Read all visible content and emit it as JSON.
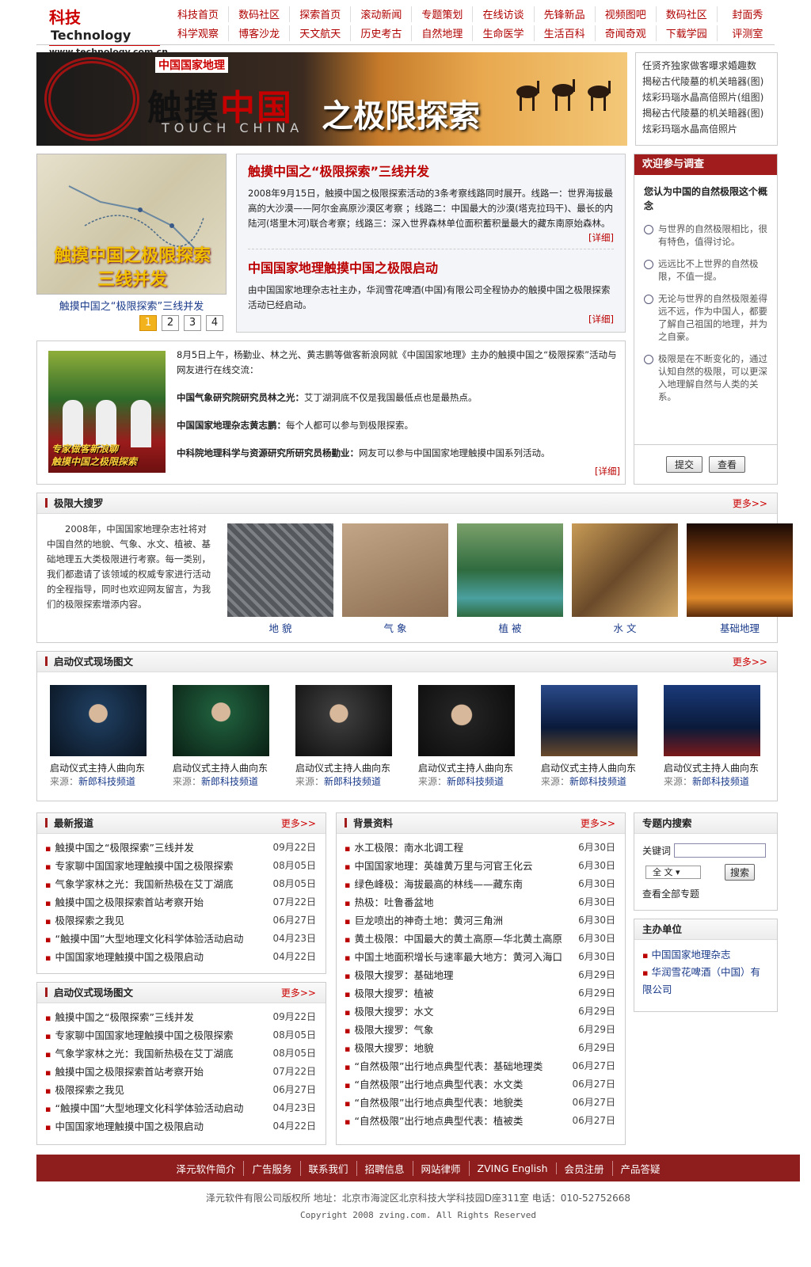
{
  "logo": {
    "cn": "科技",
    "en": "Technology",
    "url": "www.technology.com.cn"
  },
  "nav_row1": [
    "科技首页",
    "数码社区",
    "探索首页",
    "滚动新闻",
    "专题策划",
    "在线访谈",
    "先锋新品",
    "视频图吧",
    "数码社区",
    "封面秀"
  ],
  "nav_row2": [
    "科学观察",
    "博客沙龙",
    "天文航天",
    "历史考古",
    "自然地理",
    "生命医学",
    "生活百科",
    "奇闻奇观",
    "下载学园",
    "评测室"
  ],
  "banner": {
    "brand": "中国国家地理",
    "title_a": "触摸",
    "title_b": "中国",
    "english": "TOUCH CHINA",
    "title2": "之极限探索"
  },
  "banner_links": [
    "任贤齐独家做客曝求婚趣数",
    "揭秘古代陵墓的机关暗器(图)",
    "炫彩玛瑙水晶高倍照片(组图)",
    "揭秘古代陵墓的机关暗器(图)",
    "炫彩玛瑙水晶高倍照片"
  ],
  "map": {
    "overlay": "触摸中国之极限探索\n三线并发",
    "caption": "触摸中国之“极限探索”三线并发",
    "pages": [
      "1",
      "2",
      "3",
      "4"
    ]
  },
  "news": [
    {
      "title": "触摸中国之“极限探索”三线并发",
      "body": "2008年9月15日，触摸中国之极限探索活动的3条考察线路同时展开。线路一：世界海拔最高的大沙漠——阿尔金高原沙漠区考察 ；线路二：中国最大的沙漠(塔克拉玛干)、最长的内陆河(塔里木河)联合考察；线路三：深入世界森林单位面积蓄积量最大的藏东南原始森林。",
      "more": "[详细]"
    },
    {
      "title": "中国国家地理触摸中国之极限启动",
      "body": "由中国国家地理杂志社主办，华润雪花啤酒(中国)有限公司全程协办的触摸中国之极限探索活动已经启动。",
      "more": "[详细]"
    }
  ],
  "survey": {
    "header": "欢迎参与调查",
    "question": "您认为中国的自然极限这个概念",
    "options": [
      "与世界的自然极限相比，很有特色，值得讨论。",
      "远远比不上世界的自然极限，不值一提。",
      "无论与世界的自然极限差得远不远，作为中国人，都要了解自己祖国的地理，并为之自豪。",
      "极限是在不断变化的，通过认知自然的极限，可以更深入地理解自然与人类的关系。"
    ],
    "submit": "提交",
    "view": "查看"
  },
  "chat": {
    "img_text": "专家做客新浪聊\n触摸中国之极限探索",
    "intro": "8月5日上午，杨勤业、林之光、黄志鹏等做客新浪网就《中国国家地理》主办的触摸中国之“极限探索”活动与网友进行在线交流：",
    "q1_name": "中国气象研究院研究员林之光：",
    "q1_text": "艾丁湖洞底不仅是我国最低点也是最热点。",
    "q2_name": "中国国家地理杂志黄志鹏：",
    "q2_text": "每个人都可以参与到极限探索。",
    "q3_name": "中科院地理科学与资源研究所研究员杨勤业：",
    "q3_text": "网友可以参与中国国家地理触摸中国系列活动。",
    "more": "[详细]"
  },
  "sec1": {
    "title": "极限大搜罗",
    "more": "更多>>",
    "text": "2008年，中国国家地理杂志社将对中国自然的地貌、气象、水文、植被、基础地理五大类极限进行考察。每一类别，我们都邀请了该领域的权威专家进行活动的全程指导，同时也欢迎网友留言，为我们的极限探索增添内容。",
    "pics": [
      {
        "cap": "地 貌",
        "color": "#6b6e72"
      },
      {
        "cap": "气 象",
        "color": "#a9886a"
      },
      {
        "cap": "植 被",
        "color": "#2f6b3f"
      },
      {
        "cap": "水 文",
        "color": "#8a6a3a"
      },
      {
        "cap": "基础地理",
        "color": "#9a4a10"
      }
    ]
  },
  "sec2": {
    "title": "启动仪式现场图文",
    "more": "更多>>",
    "items": [
      {
        "cap": "启动仪式主持人曲向东",
        "src_label": "来源：",
        "src": "新郎科技频道"
      },
      {
        "cap": "启动仪式主持人曲向东",
        "src_label": "来源：",
        "src": "新郎科技频道"
      },
      {
        "cap": "启动仪式主持人曲向东",
        "src_label": "来源：",
        "src": "新郎科技频道"
      },
      {
        "cap": "启动仪式主持人曲向东",
        "src_label": "来源：",
        "src": "新郎科技频道"
      },
      {
        "cap": "启动仪式主持人曲向东",
        "src_label": "来源：",
        "src": "新郎科技频道"
      },
      {
        "cap": "启动仪式主持人曲向东",
        "src_label": "来源：",
        "src": "新郎科技频道"
      }
    ]
  },
  "latest": {
    "title": "最新报道",
    "more": "更多>>",
    "rows": [
      {
        "t": "触摸中国之“极限探索”三线并发",
        "d": "09月22日"
      },
      {
        "t": "专家聊中国国家地理触摸中国之极限探索",
        "d": "08月05日"
      },
      {
        "t": "气象学家林之光：我国新热极在艾丁湖底",
        "d": "08月05日"
      },
      {
        "t": "触摸中国之极限探索首站考察开始",
        "d": "07月22日"
      },
      {
        "t": "极限探索之我见",
        "d": "06月27日"
      },
      {
        "t": "“触摸中国”大型地理文化科学体验活动启动",
        "d": "04月23日"
      },
      {
        "t": "中国国家地理触摸中国之极限启动",
        "d": "04月22日"
      }
    ]
  },
  "ceremony": {
    "title": "启动仪式现场图文",
    "more": "更多>>",
    "rows": [
      {
        "t": "触摸中国之“极限探索”三线并发",
        "d": "09月22日"
      },
      {
        "t": "专家聊中国国家地理触摸中国之极限探索",
        "d": "08月05日"
      },
      {
        "t": "气象学家林之光：我国新热极在艾丁湖底",
        "d": "08月05日"
      },
      {
        "t": "触摸中国之极限探索首站考察开始",
        "d": "07月22日"
      },
      {
        "t": "极限探索之我见",
        "d": "06月27日"
      },
      {
        "t": "“触摸中国”大型地理文化科学体验活动启动",
        "d": "04月23日"
      },
      {
        "t": "中国国家地理触摸中国之极限启动",
        "d": "04月22日"
      }
    ]
  },
  "background": {
    "title": "背景资料",
    "more": "更多>>",
    "rows": [
      {
        "t": "水工极限：南水北调工程",
        "d": "6月30日"
      },
      {
        "t": "中国国家地理：英雄黄万里与河官王化云",
        "d": "6月30日"
      },
      {
        "t": "绿色峰极：海拔最高的林线——藏东南",
        "d": "6月30日"
      },
      {
        "t": "热极：吐鲁番盆地",
        "d": "6月30日"
      },
      {
        "t": "巨龙喷出的神奇土地：黄河三角洲",
        "d": "6月30日"
      },
      {
        "t": "黄土极限：中国最大的黄土高原—华北黄土高原",
        "d": "6月30日"
      },
      {
        "t": "中国土地面积增长与速率最大地方：黄河入海口",
        "d": "6月30日"
      },
      {
        "t": "极限大搜罗：基础地理",
        "d": "6月29日"
      },
      {
        "t": "极限大搜罗：植被",
        "d": "6月29日"
      },
      {
        "t": "极限大搜罗：水文",
        "d": "6月29日"
      },
      {
        "t": "极限大搜罗：气象",
        "d": "6月29日"
      },
      {
        "t": "极限大搜罗：地貌",
        "d": "6月29日"
      },
      {
        "t": "“自然极限”出行地点典型代表：基础地理类",
        "d": "06月27日"
      },
      {
        "t": "“自然极限”出行地点典型代表：水文类",
        "d": "06月27日"
      },
      {
        "t": "“自然极限”出行地点典型代表：地貌类",
        "d": "06月27日"
      },
      {
        "t": "“自然极限”出行地点典型代表：植被类",
        "d": "06月27日"
      }
    ]
  },
  "topic_search": {
    "title": "专题内搜索",
    "kw_label": "关键词",
    "select": "全 文",
    "btn": "搜索",
    "view_all": "查看全部专题"
  },
  "host": {
    "title": "主办单位",
    "items": [
      "中国国家地理杂志",
      "华润雪花啤酒（中国）有限公司"
    ]
  },
  "footer": {
    "links": [
      "泽元软件简介",
      "广告服务",
      "联系我们",
      "招聘信息",
      "网站律师",
      "ZVING English",
      "会员注册",
      "产品答疑"
    ],
    "info": "泽元软件有限公司版权所 地址：北京市海淀区北京科技大学科技园D座311室 电话：010-52752668",
    "copy": "Copyright 2008 zving.com. All Rights Reserved"
  }
}
